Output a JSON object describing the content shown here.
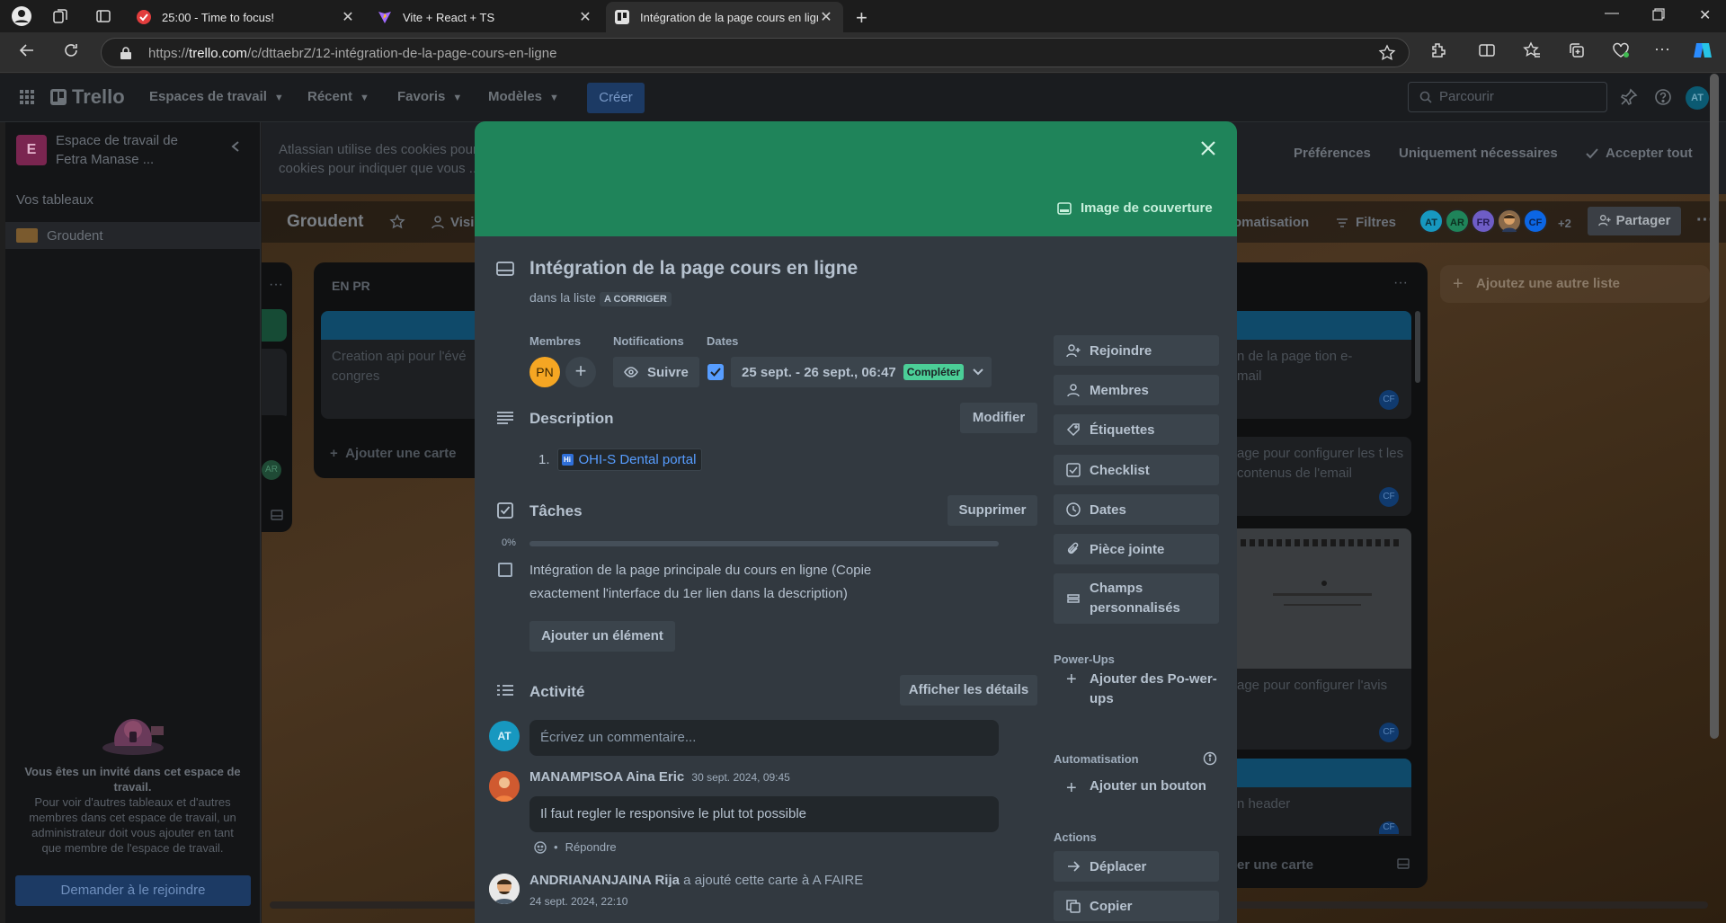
{
  "browser": {
    "tabs": [
      {
        "title": "25:00 - Time to focus!",
        "favicon_color": "#e23d3d"
      },
      {
        "title": "Vite + React + TS",
        "favicon_color": "#a26bff"
      },
      {
        "title": "Intégration de la page cours en ligne",
        "favicon_color": "#e0e0e0"
      }
    ],
    "url_prefix": "https://",
    "url_domain": "trello.com",
    "url_path": "/c/dttaebrZ/12-intégration-de-la-page-cours-en-ligne"
  },
  "header": {
    "logo": "Trello",
    "nav": [
      "Espaces de travail",
      "Récent",
      "Favoris",
      "Modèles"
    ],
    "create_label": "Créer",
    "search_placeholder": "Parcourir",
    "user_initials": "AT"
  },
  "sidebar": {
    "workspace_initial": "E",
    "workspace_name": "Espace de travail de Fetra Manase ...",
    "boards_title": "Vos tableaux",
    "board_name": "Groudent",
    "guest_title": "Vous êtes un invité dans cet espace de travail.",
    "guest_text": "Pour voir d'autres tableaux et d'autres membres dans cet espace de travail, un administrateur doit vous ajouter en tant que membre de l'espace de travail.",
    "join_label": "Demander à le rejoindre"
  },
  "cookie": {
    "text": "Atlassian utilise des cookies pour ... cookies pour indiquer que vous ...",
    "preferences": "Préférences",
    "necessary": "Uniquement nécessaires",
    "accept_all": "Accepter tout"
  },
  "board": {
    "title": "Groudent",
    "visibility": "Visi",
    "automation": "tomatisation",
    "filters": "Filtres",
    "members": [
      {
        "initials": "AT",
        "color": "#1798c0"
      },
      {
        "initials": "AR",
        "color": "#1f845a"
      },
      {
        "initials": "FR",
        "color": "#6e5dc6"
      },
      {
        "initials": "",
        "color": "#8a6a4a"
      },
      {
        "initials": "CF",
        "color": "#0c66e4"
      }
    ],
    "more_members": "+2",
    "share_label": "Partager",
    "list_en_pr": "EN PR",
    "card_en_pr": "Creation api pour l'évé congres",
    "add_card": "Ajouter une carte",
    "add_list": "Ajoutez une autre liste",
    "right_cards": [
      "n de la page tion e-mail",
      "age pour configurer les t les contenus de l'email",
      "age pour configurer l'avis",
      "n header"
    ],
    "right_add_card": "er une carte",
    "cf_badge": "CF",
    "ar_badge": "AR"
  },
  "modal": {
    "cover_label": "Image de couverture",
    "cover_color": "#1f845a",
    "title": "Intégration de la page cours en ligne",
    "in_list_prefix": "dans la liste",
    "list_name": "A CORRIGER",
    "members_label": "Membres",
    "notifications_label": "Notifications",
    "dates_label": "Dates",
    "member_initials": "PN",
    "follow_label": "Suivre",
    "date_range": "25 sept. - 26 sept., 06:47",
    "date_status": "Compléter",
    "description_title": "Description",
    "edit_label": "Modifier",
    "desc_number": "1.",
    "desc_link": "OHI-S Dental portal",
    "tasks_title": "Tâches",
    "delete_label": "Supprimer",
    "progress_text": "0%",
    "progress_value": 0,
    "task_text": "Intégration de la page principale du cours en ligne (Copie exactement l'interface du 1er lien dans la description)",
    "add_item_label": "Ajouter un élément",
    "activity_title": "Activité",
    "details_label": "Afficher les détails",
    "commenter_initials": "AT",
    "comment_placeholder": "Écrivez un commentaire...",
    "activity": [
      {
        "author": "MANAMPISOA Aina Eric",
        "date": "30 sept. 2024, 09:45",
        "comment": "Il faut regler le responsive le plut tot possible",
        "reply_sep": "•",
        "reply": "Répondre"
      },
      {
        "author": "ANDRIANANJAINA Rija",
        "action": "a ajouté cette carte à A FAIRE",
        "date": "24 sept. 2024, 22:10"
      }
    ],
    "side_buttons": [
      "Rejoindre",
      "Membres",
      "Étiquettes",
      "Checklist",
      "Dates",
      "Pièce jointe",
      "Champs personnalisés"
    ],
    "powerups_label": "Power-Ups",
    "add_powerups": "Ajouter des Po-wer-ups",
    "automation_label": "Automatisation",
    "add_button": "Ajouter un bouton",
    "actions_label": "Actions",
    "move_label": "Déplacer",
    "copy_label": "Copier"
  }
}
